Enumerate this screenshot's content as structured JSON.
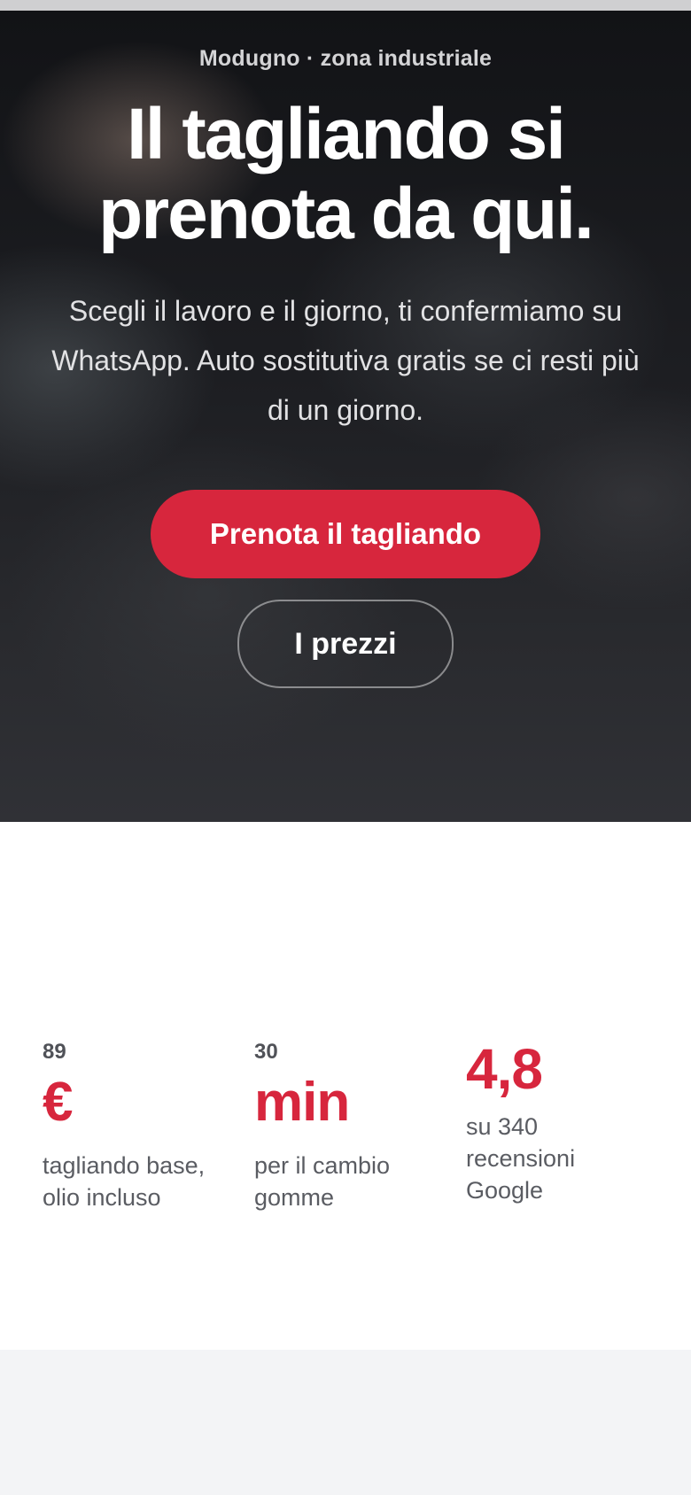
{
  "hero": {
    "eyebrow": "Modugno · zona industriale",
    "headline_line1": "Il tagliando si",
    "headline_line2": "prenota da qui.",
    "subtext": "Scegli il lavoro e il giorno, ti confermiamo su WhatsApp. Auto sostitutiva gratis se ci resti più di un giorno.",
    "primary_cta": "Prenota il tagliando",
    "secondary_cta": "I prezzi"
  },
  "stats": [
    {
      "small": "89",
      "unit": "€",
      "desc": "tagliando base, olio incluso"
    },
    {
      "small": "30",
      "unit": "min",
      "desc": "per il cambio gomme"
    },
    {
      "value": "4,8",
      "desc": "su 340 recensioni Google"
    }
  ],
  "colors": {
    "accent": "#d7263d",
    "hero_bg": "#1d1e22",
    "bottom_bg": "#f3f4f6"
  }
}
